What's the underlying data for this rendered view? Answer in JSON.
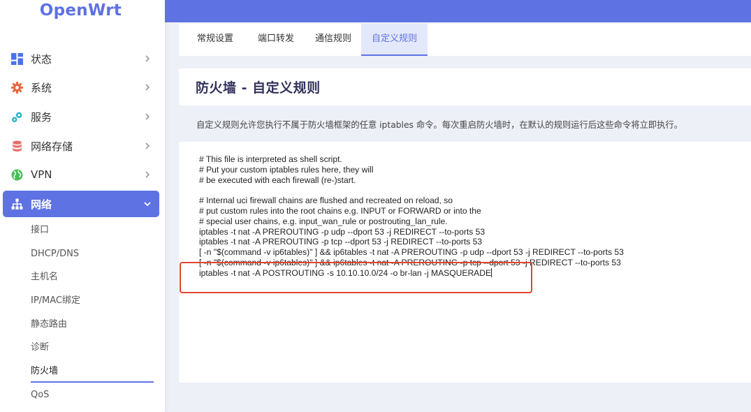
{
  "logo": "OpenWrt",
  "colors": {
    "accent": "#5e72e4",
    "highlight": "#e0462f"
  },
  "sidebar": {
    "items": [
      {
        "label": "状态",
        "icon": "dashboard-icon"
      },
      {
        "label": "系统",
        "icon": "gear-icon"
      },
      {
        "label": "服务",
        "icon": "services-icon"
      },
      {
        "label": "网络存储",
        "icon": "database-icon"
      },
      {
        "label": "VPN",
        "icon": "globe-icon"
      },
      {
        "label": "网络",
        "icon": "network-icon"
      }
    ],
    "submenu": [
      "接口",
      "DHCP/DNS",
      "主机名",
      "IP/MAC绑定",
      "静态路由",
      "诊断",
      "防火墙",
      "QoS"
    ]
  },
  "tabs": [
    "常规设置",
    "端口转发",
    "通信规则",
    "自定义规则"
  ],
  "page_title": "防火墙 - 自定义规则",
  "description": "自定义规则允许您执行不属于防火墙框架的任意 iptables 命令。每次重启防火墙时，在默认的规则运行后这些命令将立即执行。",
  "editor_lines": [
    "# This file is interpreted as shell script.",
    "# Put your custom iptables rules here, they will",
    "# be executed with each firewall (re-)start.",
    "",
    "# Internal uci firewall chains are flushed and recreated on reload, so",
    "# put custom rules into the root chains e.g. INPUT or FORWARD or into the",
    "# special user chains, e.g. input_wan_rule or postrouting_lan_rule.",
    "iptables -t nat -A PREROUTING -p udp --dport 53 -j REDIRECT --to-ports 53",
    "iptables -t nat -A PREROUTING -p tcp --dport 53 -j REDIRECT --to-ports 53",
    "[ -n \"$(command -v ip6tables)\" ] && ip6tables -t nat -A PREROUTING -p udp --dport 53 -j REDIRECT --to-ports 53",
    "[ -n \"$(command -v ip6tables)\" ] && ip6tables -t nat -A PREROUTING -p tcp --dport 53 -j REDIRECT --to-ports 53",
    "iptables -t nat -A POSTROUTING -s 10.10.10.0/24 -o br-lan -j MASQUERADE"
  ]
}
